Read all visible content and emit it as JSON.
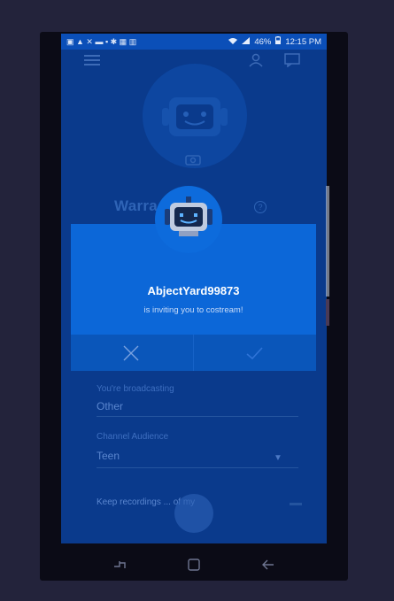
{
  "status_bar": {
    "left_icons": "▣ ▲ ✕ ▬ ▪ ✱ ▦ ▥",
    "battery": "46%",
    "time": "12:15 PM"
  },
  "background": {
    "username": "Warra... 7",
    "broadcasting_label": "You're broadcasting",
    "broadcasting_value": "Other",
    "audience_label": "Channel Audience",
    "audience_value": "Teen",
    "recording_label": "Keep recordings ... of my"
  },
  "dialog": {
    "inviter_name": "AbjectYard99873",
    "message": "is inviting you to costream!",
    "decline_icon": "close-icon",
    "accept_icon": "check-icon"
  },
  "navbar": {
    "icons": [
      "recent-apps-icon",
      "home-icon",
      "back-icon"
    ]
  }
}
